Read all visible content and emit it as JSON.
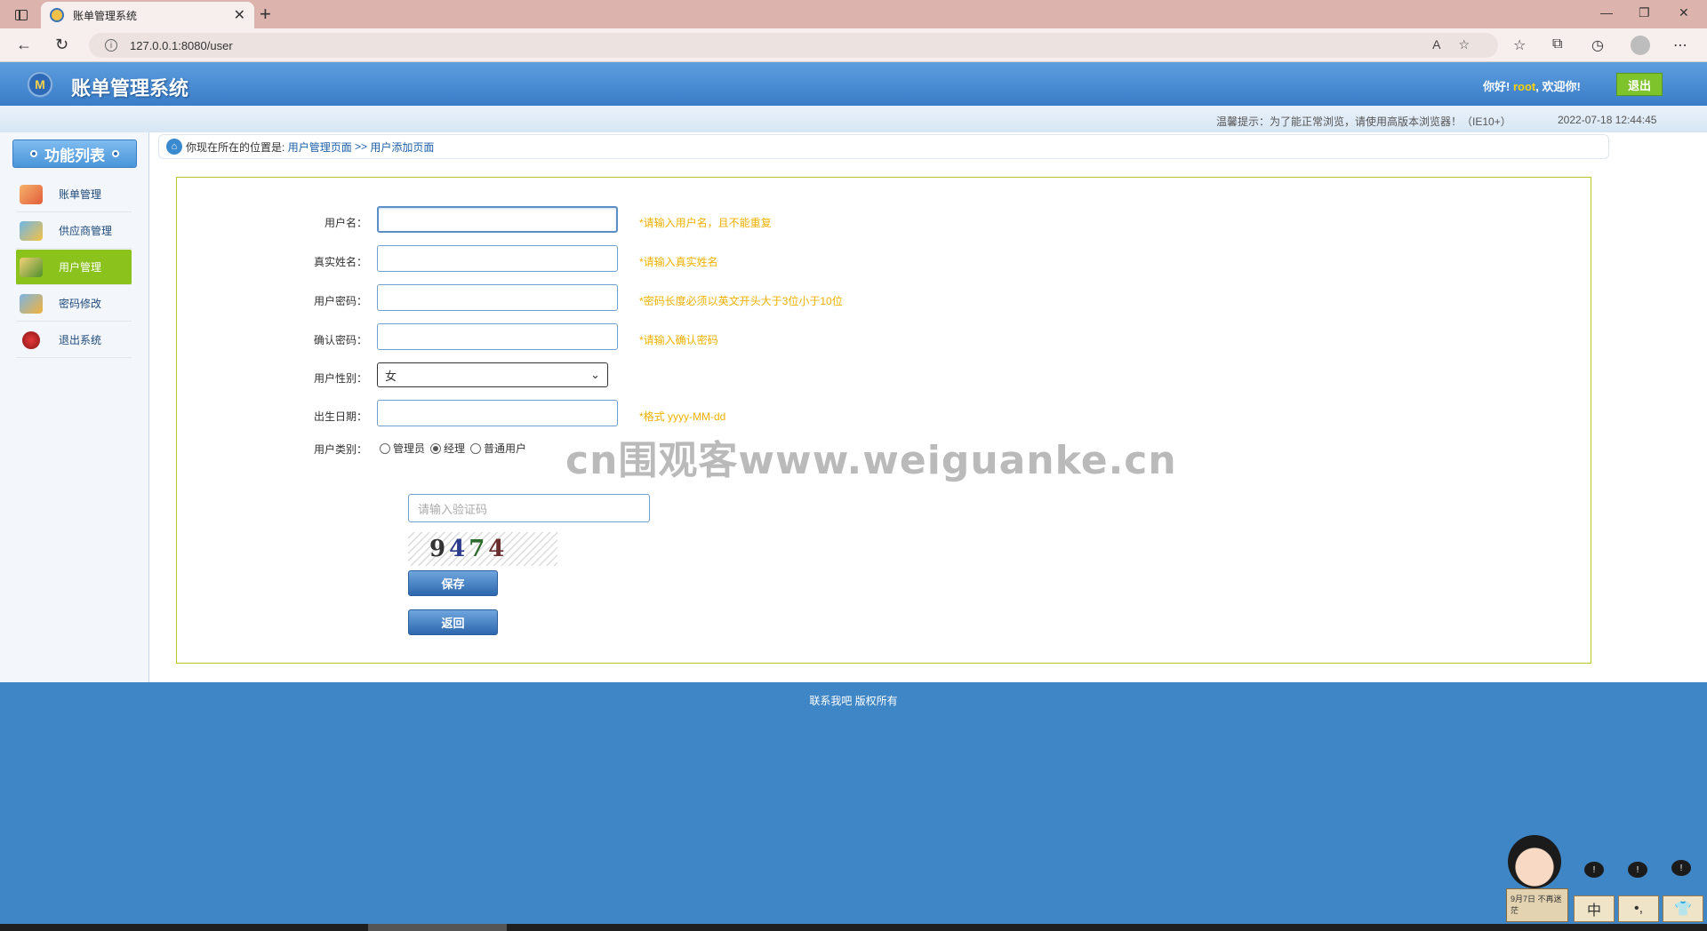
{
  "browser": {
    "tab_title": "账单管理系统",
    "url": "127.0.0.1:8080/user",
    "new_tab_glyph": "+",
    "close_glyph": "✕"
  },
  "header": {
    "title": "账单管理系统",
    "logo_text": "M",
    "greeting_prefix": "你好!",
    "username": "root",
    "greeting_suffix": ", 欢迎你!",
    "logout_label": "退出"
  },
  "infobar": {
    "tip": "温馨提示：为了能正常浏览，请使用高版本浏览器！（IE10+）",
    "datetime": "2022-07-18 12:44:45"
  },
  "sidebar": {
    "title": "功能列表",
    "items": [
      {
        "label": "账单管理",
        "icon": "bill-icon"
      },
      {
        "label": "供应商管理",
        "icon": "supplier-icon"
      },
      {
        "label": "用户管理",
        "icon": "users-icon",
        "active": true
      },
      {
        "label": "密码修改",
        "icon": "password-icon"
      },
      {
        "label": "退出系统",
        "icon": "exit-icon"
      }
    ]
  },
  "breadcrumb": {
    "prefix": "你现在所在的位置是:",
    "level1": "用户管理页面",
    "sep": ">>",
    "level2": "用户添加页面"
  },
  "form": {
    "username": {
      "label": "用户名：",
      "value": "",
      "hint": "*请输入用户名，且不能重复"
    },
    "realname": {
      "label": "真实姓名：",
      "value": "",
      "hint": "*请输入真实姓名"
    },
    "password": {
      "label": "用户密码：",
      "value": "",
      "hint": "*密码长度必须以英文开头大于3位小于10位"
    },
    "confirm": {
      "label": "确认密码：",
      "value": "",
      "hint": "*请输入确认密码"
    },
    "gender": {
      "label": "用户性别：",
      "selected": "女"
    },
    "birthday": {
      "label": "出生日期：",
      "value": "",
      "hint": "*格式 yyyy-MM-dd"
    },
    "role": {
      "label": "用户类别：",
      "options": [
        "管理员",
        "经理",
        "普通用户"
      ],
      "selected": "经理"
    },
    "captcha": {
      "placeholder": "请输入验证码",
      "digits": [
        "9",
        "4",
        "7",
        "4"
      ]
    },
    "save_label": "保存",
    "back_label": "返回"
  },
  "watermark": "cn围观客www.weiguanke.cn",
  "footer": {
    "copyright": "联系我吧 版权所有"
  },
  "mascot": {
    "board_text": "9月7日 不再迷茫",
    "boxes": [
      "中",
      "•,",
      "👕"
    ]
  },
  "colors": {
    "header_blue": "#3a7dc8",
    "active_green": "#8bc21c",
    "hint_yellow": "#f0b100",
    "footer_blue": "#3f86c6"
  }
}
